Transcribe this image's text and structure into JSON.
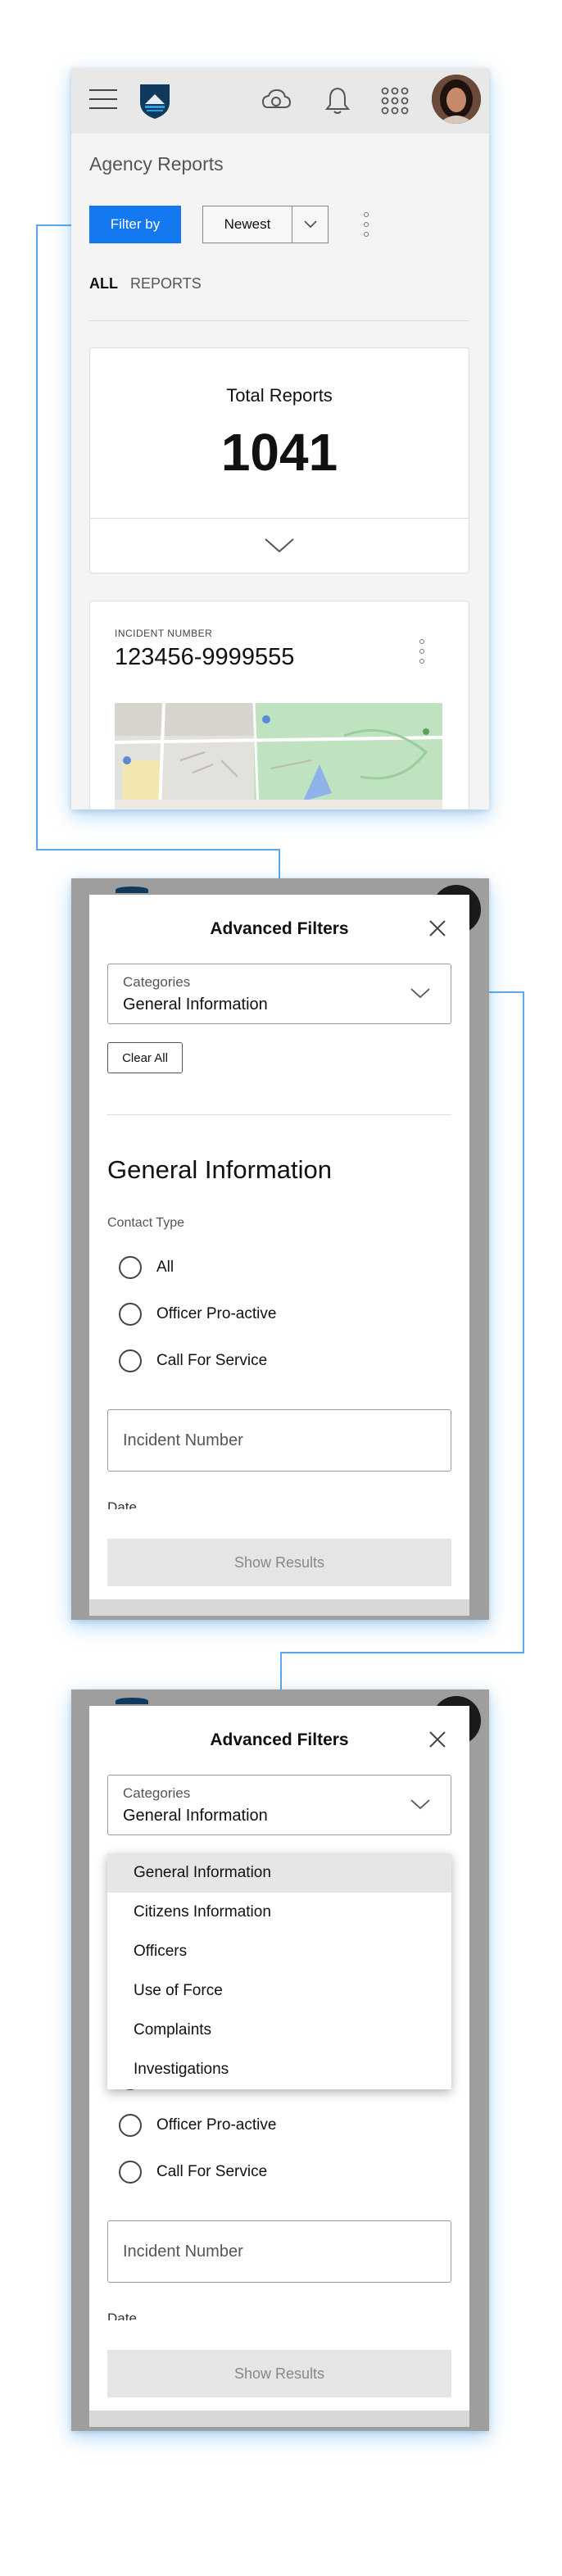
{
  "header": {
    "page_title": "Agency Reports"
  },
  "toolbar": {
    "filter_label": "Filter by",
    "sort_value": "Newest"
  },
  "tabs": {
    "all": "ALL",
    "reports": "REPORTS"
  },
  "summary": {
    "label": "Total Reports",
    "count": "1041"
  },
  "incident": {
    "label": "INCIDENT NUMBER",
    "number": "123456-9999555"
  },
  "filters": {
    "title": "Advanced Filters",
    "category_label": "Categories",
    "category_value": "General Information",
    "clear_label": "Clear All",
    "section_title": "General Information",
    "contact_type_label": "Contact Type",
    "contact_options": [
      "All",
      "Officer Pro-active",
      "Call For Service"
    ],
    "incident_placeholder": "Incident Number",
    "date_label": "Date",
    "show_results_label": "Show Results",
    "category_options": [
      "General Information",
      "Citizens Information",
      "Officers",
      "Use of Force",
      "Complaints",
      "Investigations"
    ]
  },
  "colors": {
    "accent": "#1478f0",
    "connector": "#5aa8ef",
    "overlay": "#9e9e9e"
  },
  "icons": {
    "menu": "hamburger-icon",
    "cloud": "cloud-sync-icon",
    "bell": "bell-icon",
    "apps": "grid-apps-icon",
    "more": "kebab-icon",
    "close": "close-icon",
    "chevron": "chevron-down-icon"
  }
}
